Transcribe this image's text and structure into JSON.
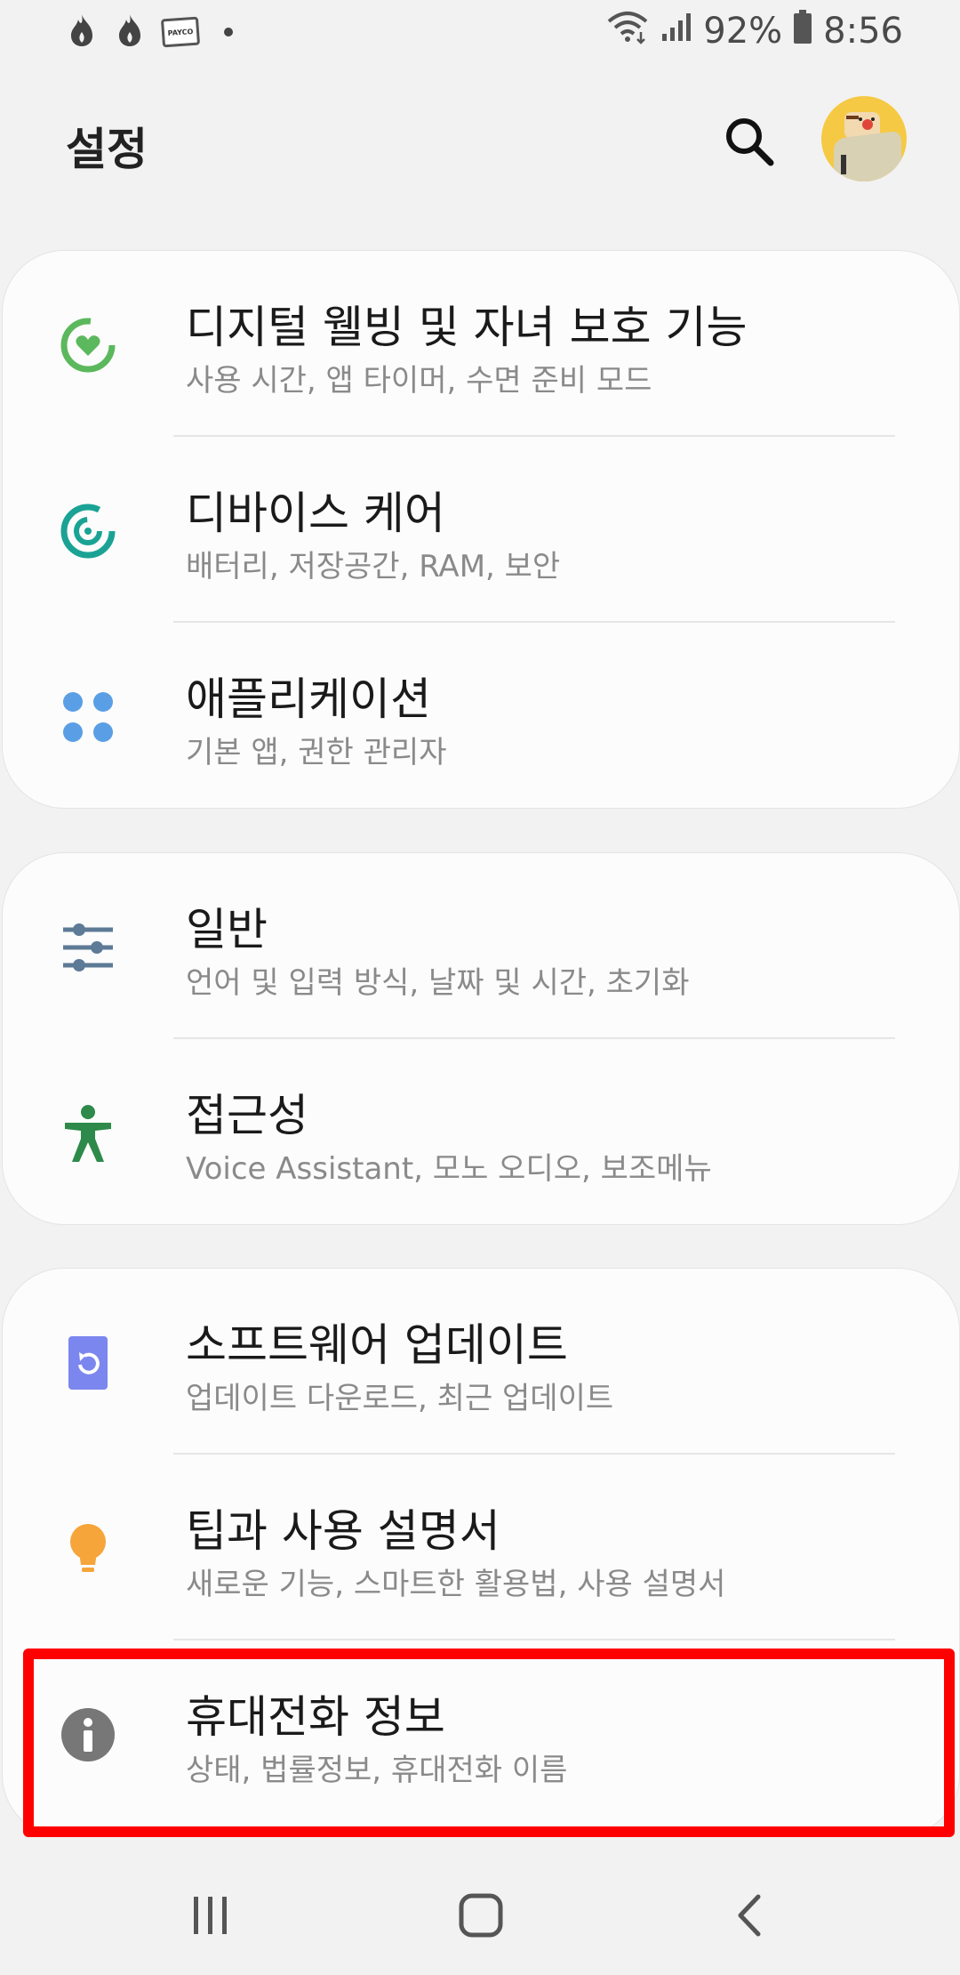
{
  "status_bar": {
    "left_icons": [
      "flame-icon",
      "flame-icon",
      "payco-icon",
      "notification-dot-icon"
    ],
    "payco_label": "PAYCO",
    "battery_percent": "92%",
    "time": "8:56"
  },
  "header": {
    "title": "설정"
  },
  "groups": [
    {
      "items": [
        {
          "title": "디지털 웰빙 및 자녀 보호 기능",
          "subtitle": "사용 시간, 앱 타이머, 수면 준비 모드",
          "icon": "digital-wellbeing-icon",
          "color": "#5cb85c"
        },
        {
          "title": "디바이스 케어",
          "subtitle": "배터리, 저장공간, RAM, 보안",
          "icon": "device-care-icon",
          "color": "#1aa394"
        },
        {
          "title": "애플리케이션",
          "subtitle": "기본 앱, 권한 관리자",
          "icon": "apps-icon",
          "color": "#5a9fe6"
        }
      ]
    },
    {
      "items": [
        {
          "title": "일반",
          "subtitle": "언어 및 입력 방식, 날짜 및 시간, 초기화",
          "icon": "general-sliders-icon",
          "color": "#5d7a96"
        },
        {
          "title": "접근성",
          "subtitle": "Voice Assistant, 모노 오디오, 보조메뉴",
          "icon": "accessibility-icon",
          "color": "#2e8a4a"
        }
      ]
    },
    {
      "items": [
        {
          "title": "소프트웨어 업데이트",
          "subtitle": "업데이트 다운로드, 최근 업데이트",
          "icon": "software-update-icon",
          "color": "#7b86ee"
        },
        {
          "title": "팁과 사용 설명서",
          "subtitle": "새로운 기능, 스마트한 활용법, 사용 설명서",
          "icon": "tips-bulb-icon",
          "color": "#f5a53a"
        },
        {
          "title": "휴대전화 정보",
          "subtitle": "상태, 법률정보, 휴대전화 이름",
          "icon": "info-icon",
          "color": "#777777"
        }
      ]
    }
  ],
  "nav_bar": {
    "buttons": [
      "recent-apps-icon",
      "home-icon",
      "back-icon"
    ]
  },
  "highlight_color": "#ff0000"
}
